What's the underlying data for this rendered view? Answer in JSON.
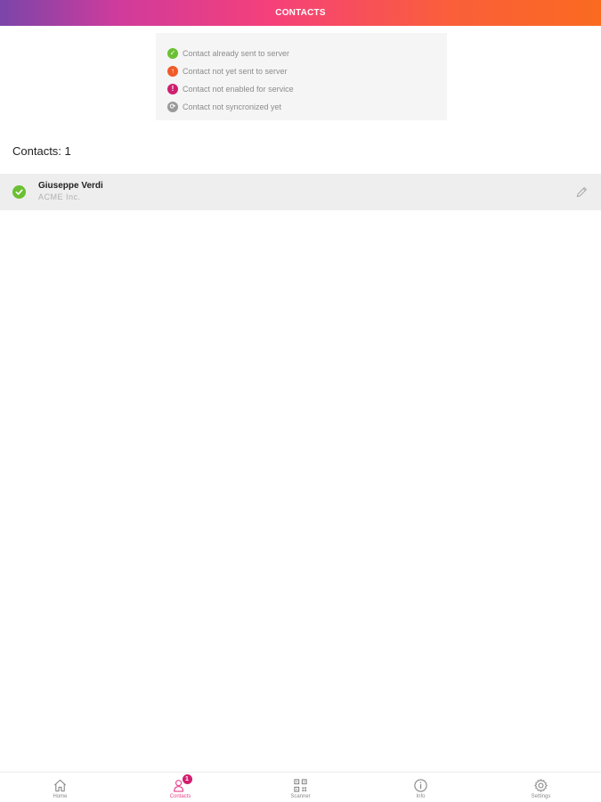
{
  "header": {
    "title": "CONTACTS"
  },
  "legend": {
    "items": [
      {
        "label": "Contact already sent to server",
        "color": "#6bc033",
        "glyph": "✓",
        "icon": "check-circle-icon"
      },
      {
        "label": "Contact not yet sent to server",
        "color": "#f05a28",
        "glyph": "↑",
        "icon": "upload-circle-icon"
      },
      {
        "label": "Contact not enabled for service",
        "color": "#cf1f6f",
        "glyph": "!",
        "icon": "alert-circle-icon"
      },
      {
        "label": "Contact not syncronized yet",
        "color": "#999999",
        "glyph": "⟳",
        "icon": "sync-circle-icon"
      }
    ]
  },
  "contacts": {
    "count_label": "Contacts:",
    "count": "1",
    "items": [
      {
        "name": "Giuseppe Verdi",
        "company": "ACME Inc.",
        "status_color": "#6bc033"
      }
    ]
  },
  "nav": {
    "items": [
      {
        "label": "Home",
        "icon": "home-icon"
      },
      {
        "label": "Contacts",
        "icon": "contacts-icon",
        "badge": "1",
        "active": true
      },
      {
        "label": "Scanner",
        "icon": "qr-scanner-icon"
      },
      {
        "label": "Info",
        "icon": "info-icon"
      },
      {
        "label": "Settings",
        "icon": "gear-icon"
      }
    ]
  },
  "colors": {
    "accent": "#e8438c",
    "header_gradient_start": "#7b45a9",
    "header_gradient_end": "#fa6a20"
  }
}
